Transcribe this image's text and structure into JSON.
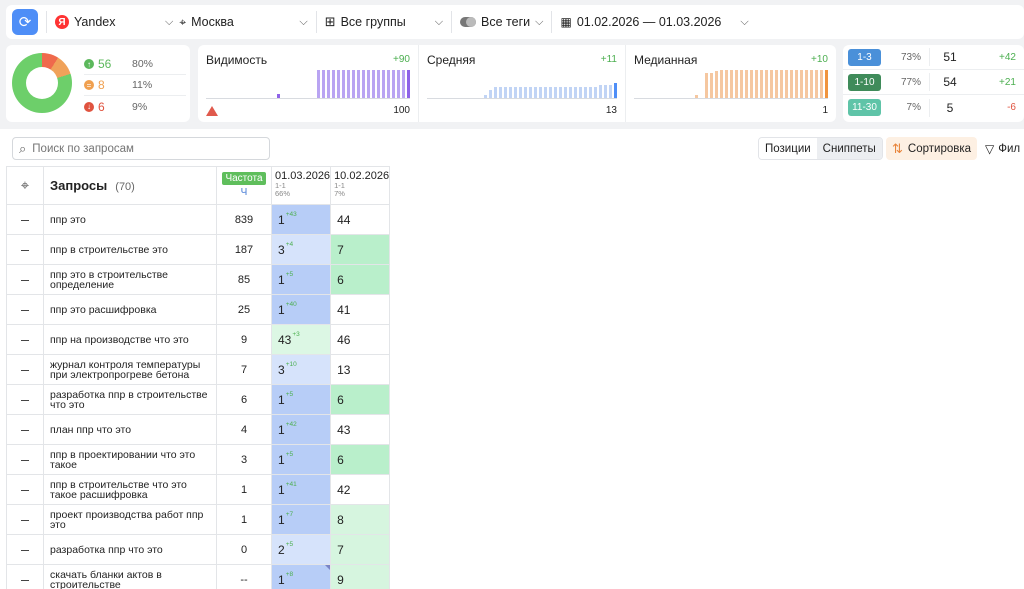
{
  "toolbar": {
    "engine": "Yandex",
    "region": "Москва",
    "groups": "Все группы",
    "tags": "Все теги",
    "date_range": "01.02.2026 — 01.03.2026"
  },
  "distribution": {
    "rows": [
      {
        "count": "56",
        "pct": "80%",
        "color": "#5cb85c",
        "icon": "arrow-up-icon"
      },
      {
        "count": "8",
        "pct": "11%",
        "color": "#f0a050",
        "icon": "equals-icon"
      },
      {
        "count": "6",
        "pct": "9%",
        "color": "#e0533f",
        "icon": "arrow-down-icon"
      }
    ]
  },
  "metrics": [
    {
      "title": "Видимость",
      "delta": "+90",
      "foot": "100",
      "color": "#b9a4f2",
      "accent": "#8f63e8",
      "bars": [
        0.15,
        0,
        0,
        0,
        0,
        0,
        0,
        0,
        1,
        1,
        1,
        1,
        1,
        1,
        1,
        1,
        1,
        1,
        1,
        1,
        1,
        1,
        1,
        1,
        1,
        1,
        1
      ]
    },
    {
      "title": "Средняя",
      "delta": "+11",
      "foot": "13",
      "color": "#c1d4f5",
      "accent": "#4e8ef7",
      "bars": [
        0.1,
        0.3,
        0.4,
        0.4,
        0.4,
        0.4,
        0.4,
        0.4,
        0.4,
        0.4,
        0.4,
        0.4,
        0.4,
        0.4,
        0.4,
        0.4,
        0.4,
        0.4,
        0.4,
        0.4,
        0.4,
        0.4,
        0.4,
        0.45,
        0.45,
        0.45,
        0.55
      ]
    },
    {
      "title": "Медианная",
      "delta": "+10",
      "foot": "1",
      "color": "#f5c7a0",
      "accent": "#f0943e",
      "bars": [
        0.1,
        0,
        0.9,
        0.9,
        0.95,
        1,
        1,
        1,
        1,
        1,
        1,
        1,
        1,
        1,
        1,
        1,
        1,
        1,
        1,
        1,
        1,
        1,
        1,
        1,
        1,
        1,
        1
      ]
    }
  ],
  "ranges": [
    {
      "label": "1-3",
      "pct": "73%",
      "count": "51",
      "delta": "+42",
      "color": "#4a90d9",
      "delta_color": "#4caf50"
    },
    {
      "label": "1-10",
      "pct": "77%",
      "count": "54",
      "delta": "+21",
      "color": "#3f8b5a",
      "delta_color": "#4caf50"
    },
    {
      "label": "11-30",
      "pct": "7%",
      "count": "5",
      "delta": "-6",
      "color": "#5fc4a8",
      "delta_color": "#e0533f"
    }
  ],
  "controls": {
    "search_placeholder": "Поиск по запросам",
    "tab_positions": "Позиции",
    "tab_snippets": "Сниппеты",
    "sort_label": "Сортировка",
    "filter_label": "Фил"
  },
  "table": {
    "title": "Запросы",
    "count": "(70)",
    "freq_header": "Частота",
    "freq_sub": "Ч",
    "dates": [
      {
        "date": "01.03.2026",
        "sub1": "1-1",
        "sub2": "66%"
      },
      {
        "date": "10.02.2026",
        "sub1": "1-1",
        "sub2": "7%"
      }
    ],
    "rows": [
      {
        "query": "ппр это",
        "freq": "839",
        "p1": "1",
        "d1": "+43",
        "c1": "#b7cdf7",
        "p2": "44",
        "c2": "#ffffff"
      },
      {
        "query": "ппр в строительстве это",
        "freq": "187",
        "p1": "3",
        "d1": "+4",
        "c1": "#d6e3fb",
        "p2": "7",
        "c2": "#b9efcb"
      },
      {
        "query": "ппр это в строительстве определение",
        "freq": "85",
        "p1": "1",
        "d1": "+5",
        "c1": "#b7cdf7",
        "p2": "6",
        "c2": "#b9efcb"
      },
      {
        "query": "ппр это расшифровка",
        "freq": "25",
        "p1": "1",
        "d1": "+40",
        "c1": "#b7cdf7",
        "p2": "41",
        "c2": "#ffffff"
      },
      {
        "query": "ппр на производстве что это",
        "freq": "9",
        "p1": "43",
        "d1": "+3",
        "c1": "#dcf7e4",
        "p2": "46",
        "c2": "#ffffff"
      },
      {
        "query": "журнал контроля температуры при электропрогреве бетона",
        "freq": "7",
        "p1": "3",
        "d1": "+10",
        "c1": "#d6e3fb",
        "p2": "13",
        "c2": "#ffffff"
      },
      {
        "query": "разработка ппр в строительстве что это",
        "freq": "6",
        "p1": "1",
        "d1": "+5",
        "c1": "#b7cdf7",
        "p2": "6",
        "c2": "#b9efcb"
      },
      {
        "query": "план ппр что это",
        "freq": "4",
        "p1": "1",
        "d1": "+42",
        "c1": "#b7cdf7",
        "p2": "43",
        "c2": "#ffffff"
      },
      {
        "query": "ппр в проектировании что это такое",
        "freq": "3",
        "p1": "1",
        "d1": "+5",
        "c1": "#b7cdf7",
        "p2": "6",
        "c2": "#b9efcb"
      },
      {
        "query": "ппр в строительстве что это такое расшифровка",
        "freq": "1",
        "p1": "1",
        "d1": "+41",
        "c1": "#b7cdf7",
        "p2": "42",
        "c2": "#ffffff"
      },
      {
        "query": "проект производства работ ппр это",
        "freq": "1",
        "p1": "1",
        "d1": "+7",
        "c1": "#b7cdf7",
        "p2": "8",
        "c2": "#d6f5df"
      },
      {
        "query": "разработка ппр что это",
        "freq": "0",
        "p1": "2",
        "d1": "+5",
        "c1": "#d6e3fb",
        "p2": "7",
        "c2": "#d6f5df"
      },
      {
        "query": "скачать бланки актов в строительстве",
        "freq": "--",
        "p1": "1",
        "d1": "+8",
        "c1": "#b7cdf7",
        "p2": "9",
        "c2": "#d6f5df",
        "corner": true
      }
    ]
  }
}
